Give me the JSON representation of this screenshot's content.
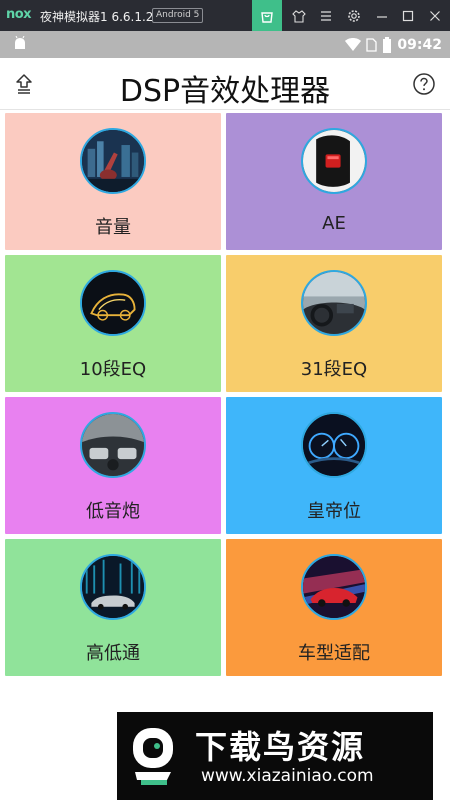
{
  "emulator": {
    "logo": "nox",
    "title": "夜神模拟器1 6.6.1.2",
    "android_badge": "Android 5",
    "toolbar_icons": [
      "shop-icon",
      "shirt-icon",
      "menu-icon",
      "gear-icon",
      "minimize-icon",
      "maximize-icon",
      "close-icon"
    ],
    "active_color": "#3fbf8a"
  },
  "status_bar": {
    "time": "09:42",
    "icons": [
      "android-icon",
      "wifi-icon",
      "sim-icon",
      "battery-icon"
    ]
  },
  "header": {
    "title": "DSP音效处理器",
    "left_icon": "back-upload-icon",
    "right_icon": "help-icon"
  },
  "tiles": [
    {
      "label": "音量",
      "color": "#fbcbc1",
      "icon": "city-guitar-image"
    },
    {
      "label": "AE",
      "color": "#ac90d6",
      "icon": "car-light-image"
    },
    {
      "label": "10段EQ",
      "color": "#a2e592",
      "icon": "car-wireframe-image"
    },
    {
      "label": "31段EQ",
      "color": "#f8cd6b",
      "icon": "car-interior-image"
    },
    {
      "label": "低音炮",
      "color": "#e881f0",
      "icon": "dashboard-image"
    },
    {
      "label": "皇帝位",
      "color": "#3fb6fa",
      "icon": "speedometer-image"
    },
    {
      "label": "高低通",
      "color": "#90e39a",
      "icon": "car-city-image"
    },
    {
      "label": "车型适配",
      "color": "#fb9a3d",
      "icon": "sports-car-image"
    }
  ],
  "watermark": {
    "title": "下载鸟资源",
    "url": "www.xiazainiao.com"
  }
}
